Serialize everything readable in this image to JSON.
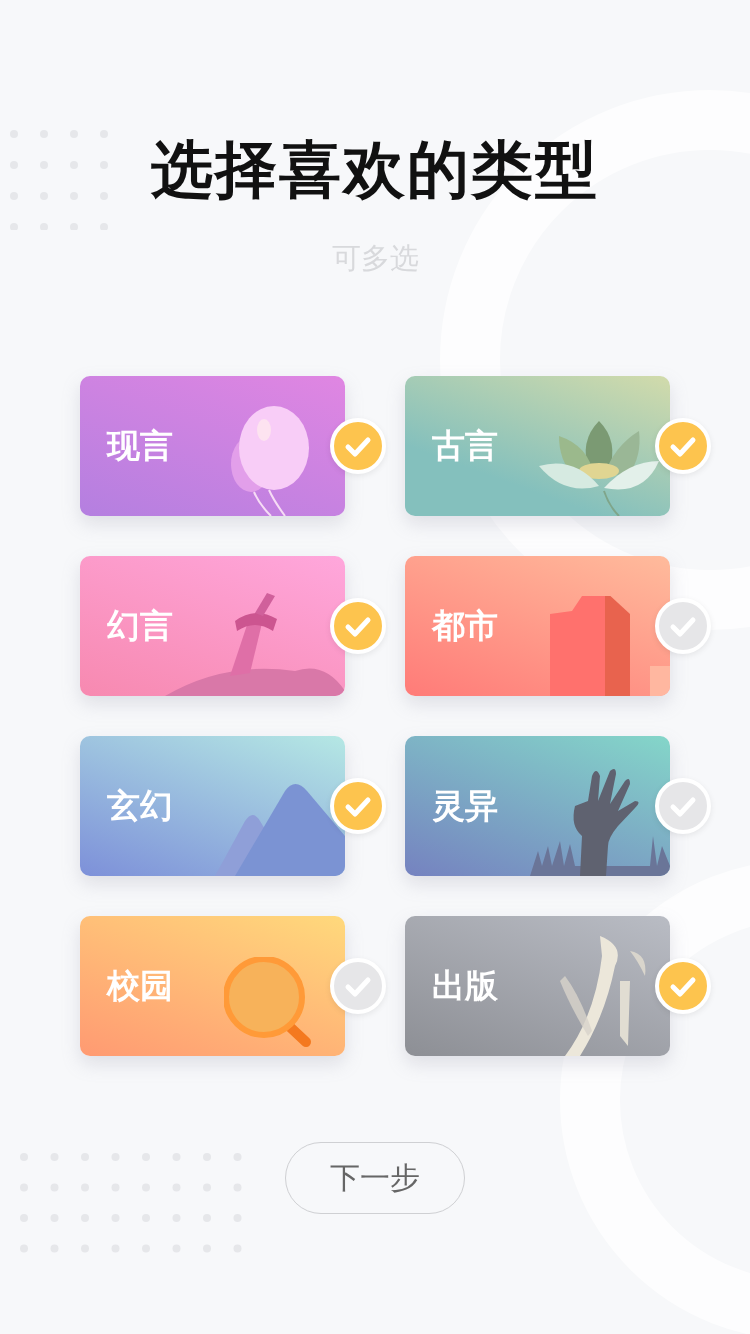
{
  "title": "选择喜欢的类型",
  "subtitle": "可多选",
  "genres": [
    {
      "label": "现言",
      "kind": "balloon",
      "selected": true
    },
    {
      "label": "古言",
      "kind": "lotus",
      "selected": true
    },
    {
      "label": "幻言",
      "kind": "sword",
      "selected": true
    },
    {
      "label": "都市",
      "kind": "building",
      "selected": false
    },
    {
      "label": "玄幻",
      "kind": "mountain",
      "selected": true
    },
    {
      "label": "灵异",
      "kind": "hand",
      "selected": false
    },
    {
      "label": "校园",
      "kind": "magnifier",
      "selected": false
    },
    {
      "label": "出版",
      "kind": "brush",
      "selected": true
    }
  ],
  "next_button": "下一步"
}
